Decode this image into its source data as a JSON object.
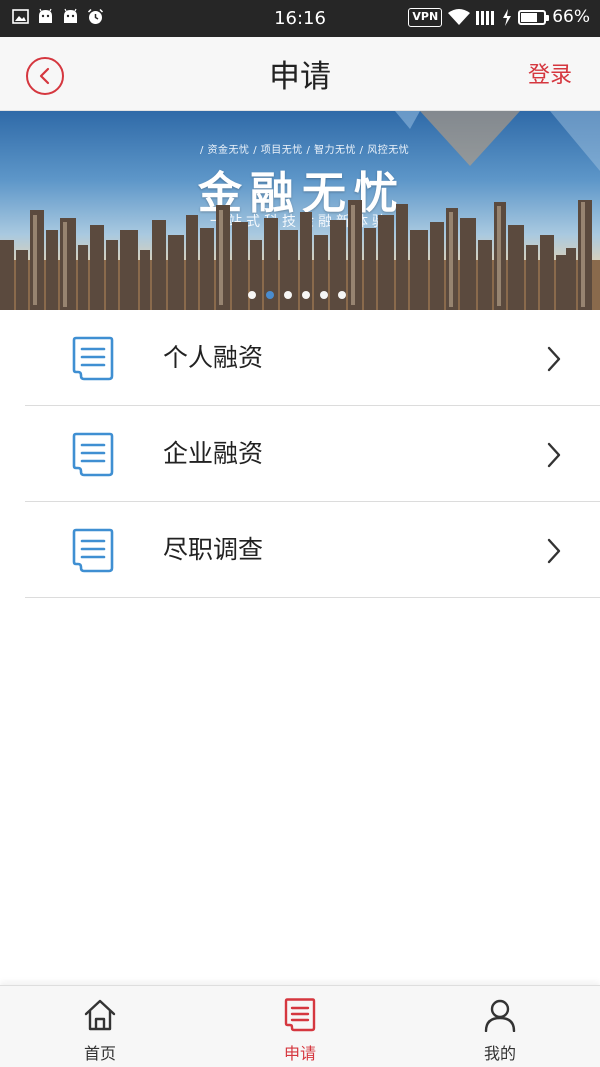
{
  "status_bar": {
    "time": "16:16",
    "vpn": "VPN",
    "battery": "66%",
    "battery_level": 0.66,
    "left_icons": [
      "image-icon",
      "android-icon",
      "android-icon",
      "alarm-icon"
    ]
  },
  "header": {
    "title": "申请",
    "login": "登录",
    "back_icon": "back-circle-icon"
  },
  "banner": {
    "tagline": "/ 资金无忧 / 项目无忧 / 智力无忧 / 风控无忧",
    "title": "金融无忧",
    "subtitle": "一站式科技金融新体验",
    "slide_count": 6,
    "active_slide": 1
  },
  "list": {
    "items": [
      {
        "label": "个人融资",
        "icon": "document-icon"
      },
      {
        "label": "企业融资",
        "icon": "document-icon"
      },
      {
        "label": "尽职调查",
        "icon": "document-icon"
      }
    ]
  },
  "bottom_nav": {
    "tabs": [
      {
        "label": "首页",
        "icon": "home-icon",
        "active": false
      },
      {
        "label": "申请",
        "icon": "document-icon",
        "active": true
      },
      {
        "label": "我的",
        "icon": "user-icon",
        "active": false
      }
    ]
  },
  "colors": {
    "accent": "#d5373f",
    "icon_blue": "#3f8fd2",
    "status_bar": "#262626"
  }
}
